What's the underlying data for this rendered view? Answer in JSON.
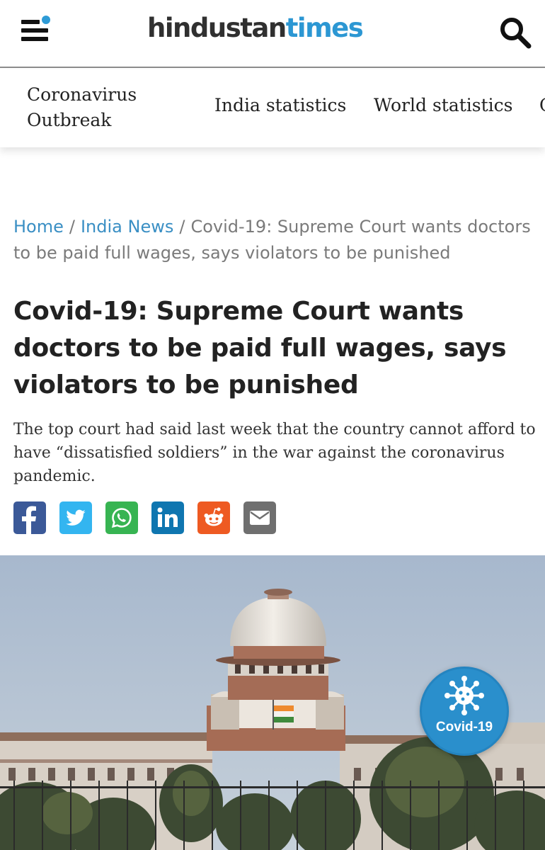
{
  "header": {
    "logo_part1": "hindustan",
    "logo_part2": "times",
    "menu_icon": "hamburger-menu-icon",
    "search_icon": "search-icon",
    "accent_color": "#2c97d3"
  },
  "nav": {
    "items": [
      {
        "label": "Coronavirus Outbreak"
      },
      {
        "label": "India statistics"
      },
      {
        "label": "World statistics"
      },
      {
        "label": "C"
      }
    ]
  },
  "breadcrumb": {
    "home": "Home",
    "separator": "/",
    "section": "India News",
    "current": "Covid-19: Supreme Court wants doctors to be paid full wages, says violators to be punished"
  },
  "article": {
    "headline": "Covid-19: Supreme Court wants doctors to be paid full wages, says violators to be punished",
    "summary": "The top court had said last week that the country cannot afford to have “dissatisfied soldiers” in the war against the coronavirus pandemic."
  },
  "share": {
    "buttons": [
      {
        "icon": "facebook-icon",
        "color": "#3b5998"
      },
      {
        "icon": "twitter-icon",
        "color": "#33b5f0"
      },
      {
        "icon": "whatsapp-icon",
        "color": "#37b452"
      },
      {
        "icon": "linkedin-icon",
        "color": "#0f76b0"
      },
      {
        "icon": "reddit-icon",
        "color": "#ee5a22"
      },
      {
        "icon": "email-icon",
        "color": "#6f6f6f"
      }
    ]
  },
  "covid_badge": {
    "label": "Covid-19",
    "icon": "virus-icon",
    "color": "#2a8fcc"
  }
}
